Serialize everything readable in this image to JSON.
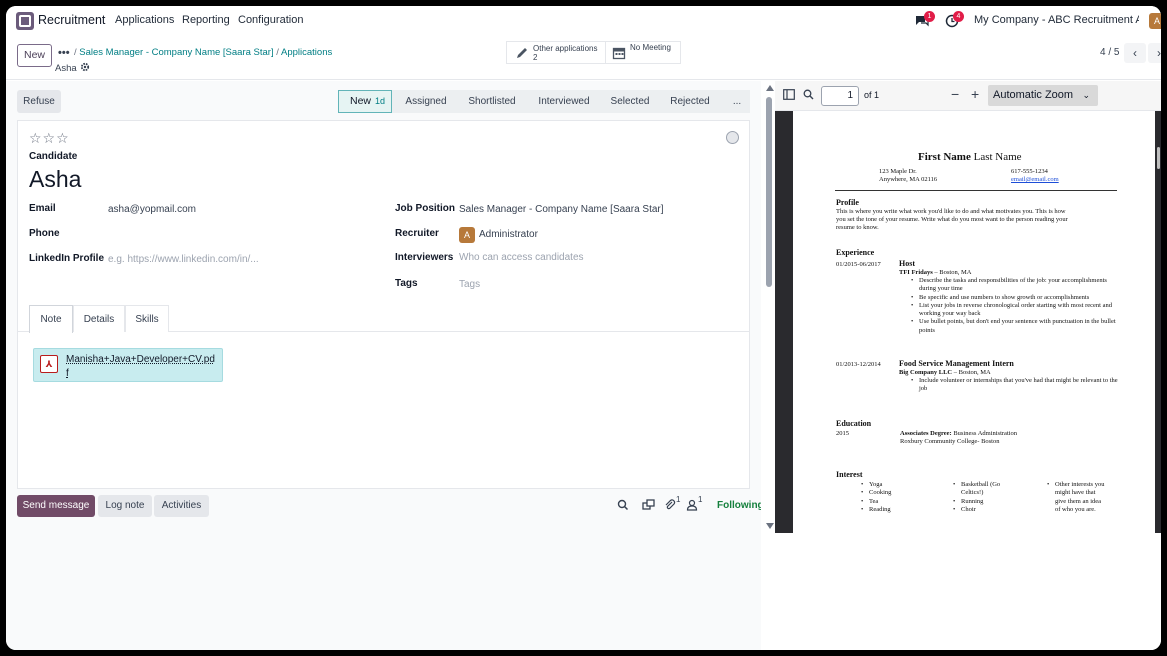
{
  "navbar": {
    "brand": "Recruitment",
    "menu": [
      "Applications",
      "Reporting",
      "Configuration"
    ],
    "messages_badge": "1",
    "activities_badge": "4",
    "company": "My Company - ABC Recruitment Age...",
    "user_initial": "A"
  },
  "control_panel": {
    "new_label": "New",
    "breadcrumb": [
      "Sales Manager - Company Name [Saara Star]",
      "Applications"
    ],
    "record_name": "Asha",
    "other_apps_label": "Other applications",
    "other_apps_count": "2",
    "meeting_label": "No Meeting",
    "pager": "4 / 5"
  },
  "statusbar": {
    "refuse_label": "Refuse",
    "active_stage": "New",
    "active_stage_duration": "1d",
    "stages": [
      "Assigned",
      "Shortlisted",
      "Interviewed",
      "Selected",
      "Rejected",
      "..."
    ]
  },
  "form": {
    "candidate_label": "Candidate",
    "candidate_name": "Asha",
    "email_label": "Email",
    "email_value": "asha@yopmail.com",
    "phone_label": "Phone",
    "linkedin_label": "LinkedIn Profile",
    "linkedin_placeholder": "e.g. https://www.linkedin.com/in/...",
    "job_position_label": "Job Position",
    "job_position_value": "Sales Manager - Company Name [Saara Star]",
    "recruiter_label": "Recruiter",
    "recruiter_initial": "A",
    "recruiter_value": "Administrator",
    "interviewers_label": "Interviewers",
    "interviewers_placeholder": "Who can access candidates",
    "tags_label": "Tags",
    "tags_placeholder": "Tags",
    "tabs": [
      "Note",
      "Details",
      "Skills"
    ],
    "attachment_name": "Manisha+Java+Developer+CV.pdf"
  },
  "chatter": {
    "send_message": "Send message",
    "log_note": "Log note",
    "activities": "Activities",
    "attachments_count": "1",
    "followers_count": "1",
    "following": "Following"
  },
  "pdf_viewer": {
    "page_number": "1",
    "of_pages": "of 1",
    "zoom": "Automatic Zoom",
    "resume": {
      "first_name": "First Name",
      "last_name": "Last Name",
      "address1": "123 Maple Dr.",
      "address2": "Anywhere, MA 02116",
      "phone": "617-555-1234",
      "email": "email@email.com",
      "profile_title": "Profile",
      "profile_lines": [
        "This is where you write what work you'd like to do and what motivates you. This is how",
        "you set the tone of your resume. Write what do you most want to the person reading your",
        "resume to know."
      ],
      "experience_title": "Experience",
      "job1_dates": "01/2015-06/2017",
      "job1_title": "Host",
      "job1_company": "TFI Fridays",
      "job1_location": "– Boston, MA",
      "job1_bullets": [
        "Describe the tasks and responsibilities of the job: your accomplishments during your time",
        "Be specific and use numbers to show growth or accomplishments",
        "List your jobs in reverse chronological order starting with most recent and working your way back",
        "Use bullet points, but don't end your sentence with punctuation in the bullet points"
      ],
      "job2_dates": "01/2013-12/2014",
      "job2_title": "Food Service Management Intern",
      "job2_company": "Big Company LLC",
      "job2_location": "– Boston, MA",
      "job2_bullets": [
        "Include volunteer or internships that you've had that might be relevant to the job"
      ],
      "education_title": "Education",
      "edu_year": "2015",
      "edu_degree_label": "Associates Degree:",
      "edu_degree": " Business Administration",
      "edu_school": "Roxbury Community College- Boston",
      "interest_title": "Interest",
      "interest_col1": [
        "Yoga",
        "Cooking",
        "Tea",
        "Reading"
      ],
      "interest_col2": [
        "Basketball (Go Celtics!)",
        "Running",
        "Choir"
      ],
      "interest_col3": [
        "Other interests you might have that give them an idea of who you are."
      ]
    }
  }
}
